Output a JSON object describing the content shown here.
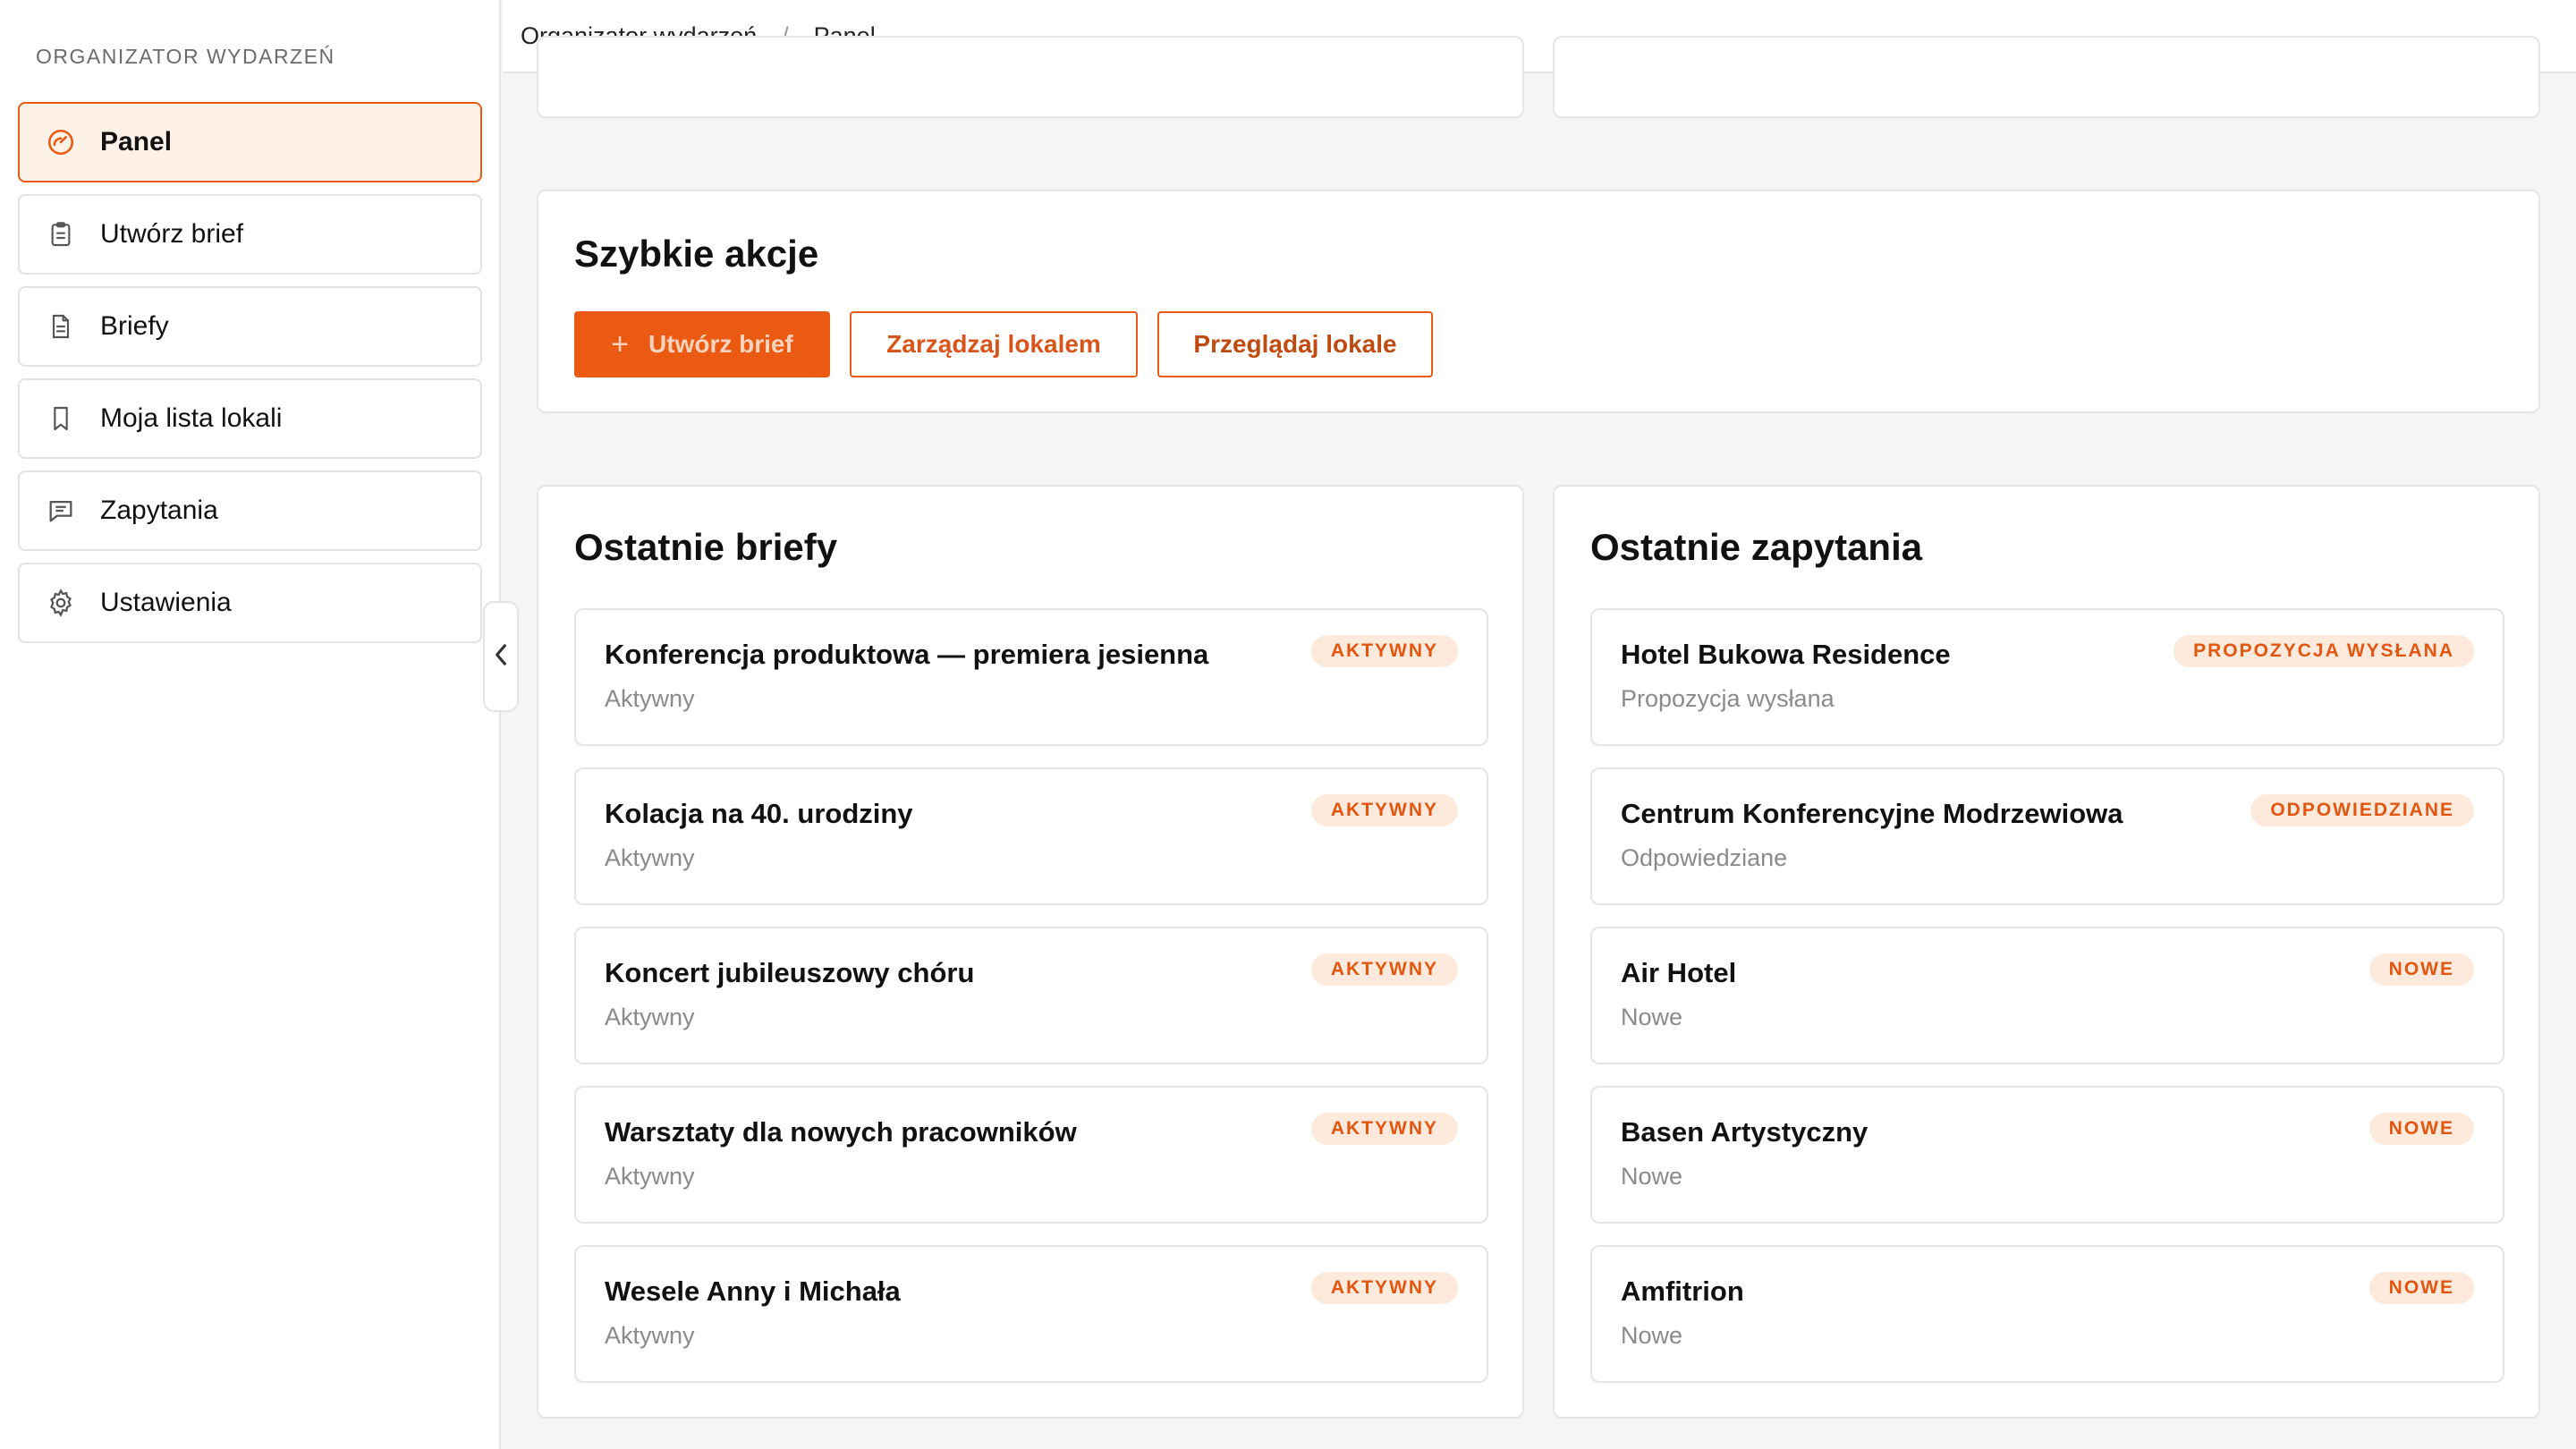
{
  "sidebar": {
    "brand": "ORGANIZATOR WYDARZEŃ",
    "items": [
      {
        "label": "Panel",
        "icon": "gauge-icon"
      },
      {
        "label": "Utwórz brief",
        "icon": "clipboard-icon"
      },
      {
        "label": "Briefy",
        "icon": "document-icon"
      },
      {
        "label": "Moja lista lokali",
        "icon": "bookmark-icon"
      },
      {
        "label": "Zapytania",
        "icon": "message-icon"
      },
      {
        "label": "Ustawienia",
        "icon": "gear-icon"
      }
    ],
    "active_index": 0
  },
  "breadcrumb": {
    "root": "Organizator wydarzeń",
    "separator": "/",
    "current": "Panel"
  },
  "quick_actions": {
    "title": "Szybkie akcje",
    "create_label": "Utwórz brief",
    "manage_label": "Zarządzaj lokalem",
    "browse_label": "Przeglądaj lokale"
  },
  "recent_briefs": {
    "title": "Ostatnie briefy",
    "items": [
      {
        "title": "Konferencja produktowa — premiera jesienna",
        "status": "Aktywny",
        "badge": "AKTYWNY"
      },
      {
        "title": "Kolacja na 40. urodziny",
        "status": "Aktywny",
        "badge": "AKTYWNY"
      },
      {
        "title": "Koncert jubileuszowy chóru",
        "status": "Aktywny",
        "badge": "AKTYWNY"
      },
      {
        "title": "Warsztaty dla nowych pracowników",
        "status": "Aktywny",
        "badge": "AKTYWNY"
      },
      {
        "title": "Wesele Anny i Michała",
        "status": "Aktywny",
        "badge": "AKTYWNY"
      }
    ]
  },
  "recent_inquiries": {
    "title": "Ostatnie zapytania",
    "items": [
      {
        "title": "Hotel Bukowa Residence",
        "status": "Propozycja wysłana",
        "badge": "PROPOZYCJA WYSŁANA"
      },
      {
        "title": "Centrum Konferencyjne Modrzewiowa",
        "status": "Odpowiedziane",
        "badge": "ODPOWIEDZIANE"
      },
      {
        "title": "Air Hotel",
        "status": "Nowe",
        "badge": "NOWE"
      },
      {
        "title": "Basen Artystyczny",
        "status": "Nowe",
        "badge": "NOWE"
      },
      {
        "title": "Amfitrion",
        "status": "Nowe",
        "badge": "NOWE"
      }
    ]
  },
  "colors": {
    "accent": "#ea5a12",
    "active_bg": "#fdf1e8",
    "badge_bg": "#fdeadd"
  }
}
